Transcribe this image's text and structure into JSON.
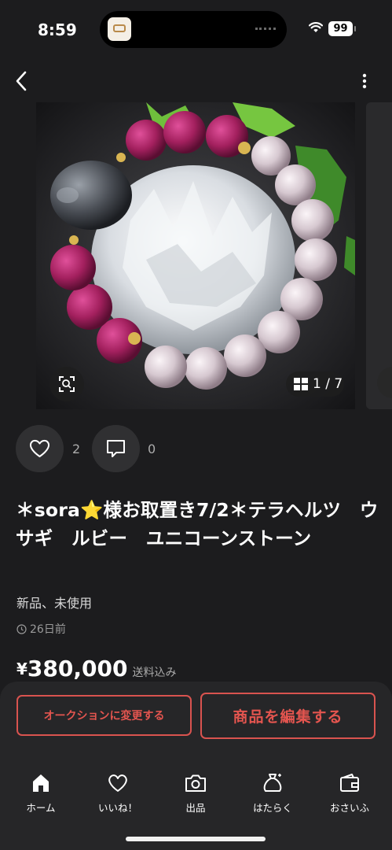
{
  "status_bar": {
    "time": "8:59",
    "battery": "99"
  },
  "gallery": {
    "counter": "1 / 7"
  },
  "engagement": {
    "likes": "2",
    "comments": "0"
  },
  "item": {
    "title": "＊sora⭐️様お取置き7/2＊テラヘルツ　ウサギ　ルビー　ユニコーンストーン",
    "condition": "新品、未使用",
    "posted": "26日前",
    "currency": "¥",
    "price": "380,000",
    "shipping": "送料込み"
  },
  "actions": {
    "auction_label": "オークションに変更する",
    "edit_label": "商品を編集する"
  },
  "tabbar": {
    "items": [
      {
        "label": "ホーム",
        "icon": "home-icon"
      },
      {
        "label": "いいね！",
        "icon": "heart-icon"
      },
      {
        "label": "出品",
        "icon": "camera-icon"
      },
      {
        "label": "はたらく",
        "icon": "money-bag-icon"
      },
      {
        "label": "おさいふ",
        "icon": "wallet-icon"
      }
    ]
  },
  "colors": {
    "accent": "#e4554f",
    "background": "#1c1c1e"
  }
}
